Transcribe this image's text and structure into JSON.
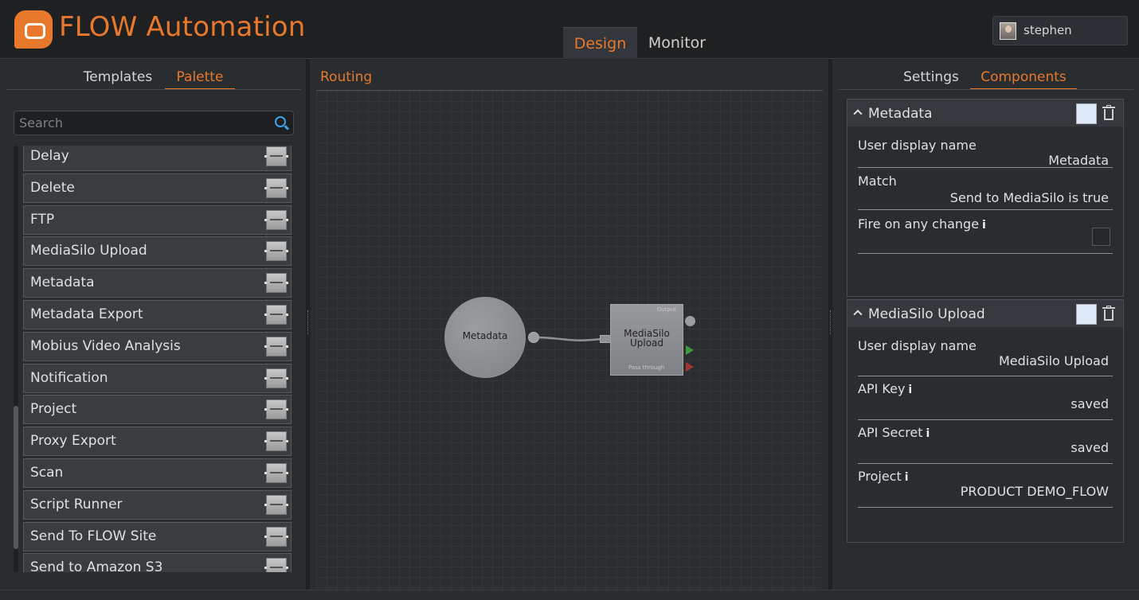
{
  "header": {
    "app_title": "FLOW Automation",
    "tabs": [
      {
        "label": "Design",
        "active": true
      },
      {
        "label": "Monitor",
        "active": false
      }
    ],
    "user": "stephen"
  },
  "left_panel": {
    "tabs": [
      {
        "label": "Templates"
      },
      {
        "label": "Palette",
        "active": true
      }
    ],
    "search_placeholder": "Search",
    "items": [
      {
        "label": "Delay",
        "thumb": "Delay"
      },
      {
        "label": "Delete",
        "thumb": "Delete"
      },
      {
        "label": "FTP",
        "thumb": "FTP"
      },
      {
        "label": "MediaSilo Upload",
        "thumb": "MediaSilo Upload"
      },
      {
        "label": "Metadata",
        "thumb": "Metadata"
      },
      {
        "label": "Metadata Export",
        "thumb": "Metadata Export"
      },
      {
        "label": "Mobius Video Analysis",
        "thumb": "Mobius Video Analysis"
      },
      {
        "label": "Notification",
        "thumb": "Notification"
      },
      {
        "label": "Project",
        "thumb": "Project"
      },
      {
        "label": "Proxy Export",
        "thumb": "Proxy Export"
      },
      {
        "label": "Scan",
        "thumb": "Scan"
      },
      {
        "label": "Script Runner",
        "thumb": "Script Runner"
      },
      {
        "label": "Send To FLOW Site",
        "thumb": "Send To FLOW Site"
      },
      {
        "label": "Send to Amazon S3",
        "thumb": "Send to S3"
      }
    ]
  },
  "center_panel": {
    "tab": "Routing",
    "nodes": {
      "metadata": "Metadata",
      "mediasilo_line1": "MediaSilo",
      "mediasilo_line2": "Upload",
      "output_label": "Output",
      "pass_label": "Pass through"
    }
  },
  "right_panel": {
    "tabs": [
      {
        "label": "Settings"
      },
      {
        "label": "Components",
        "active": true
      }
    ],
    "components": [
      {
        "title": "Metadata",
        "fields": [
          {
            "label": "User display name",
            "value": "Metadata"
          },
          {
            "label": "Match",
            "value": "Send to MediaSilo is true"
          },
          {
            "label": "Fire on any change",
            "info": "i",
            "checkbox": true
          }
        ]
      },
      {
        "title": "MediaSilo Upload",
        "fields": [
          {
            "label": "User display name",
            "value": "MediaSilo Upload"
          },
          {
            "label": "API Key",
            "info": "i",
            "value": "saved"
          },
          {
            "label": "API Secret",
            "info": "i",
            "value": "saved"
          },
          {
            "label": "Project",
            "info": "i",
            "value": "PRODUCT DEMO_FLOW"
          }
        ]
      }
    ]
  },
  "colors": {
    "accent": "#e8782c",
    "background": "#232527",
    "swatch": "#dde9f7"
  }
}
